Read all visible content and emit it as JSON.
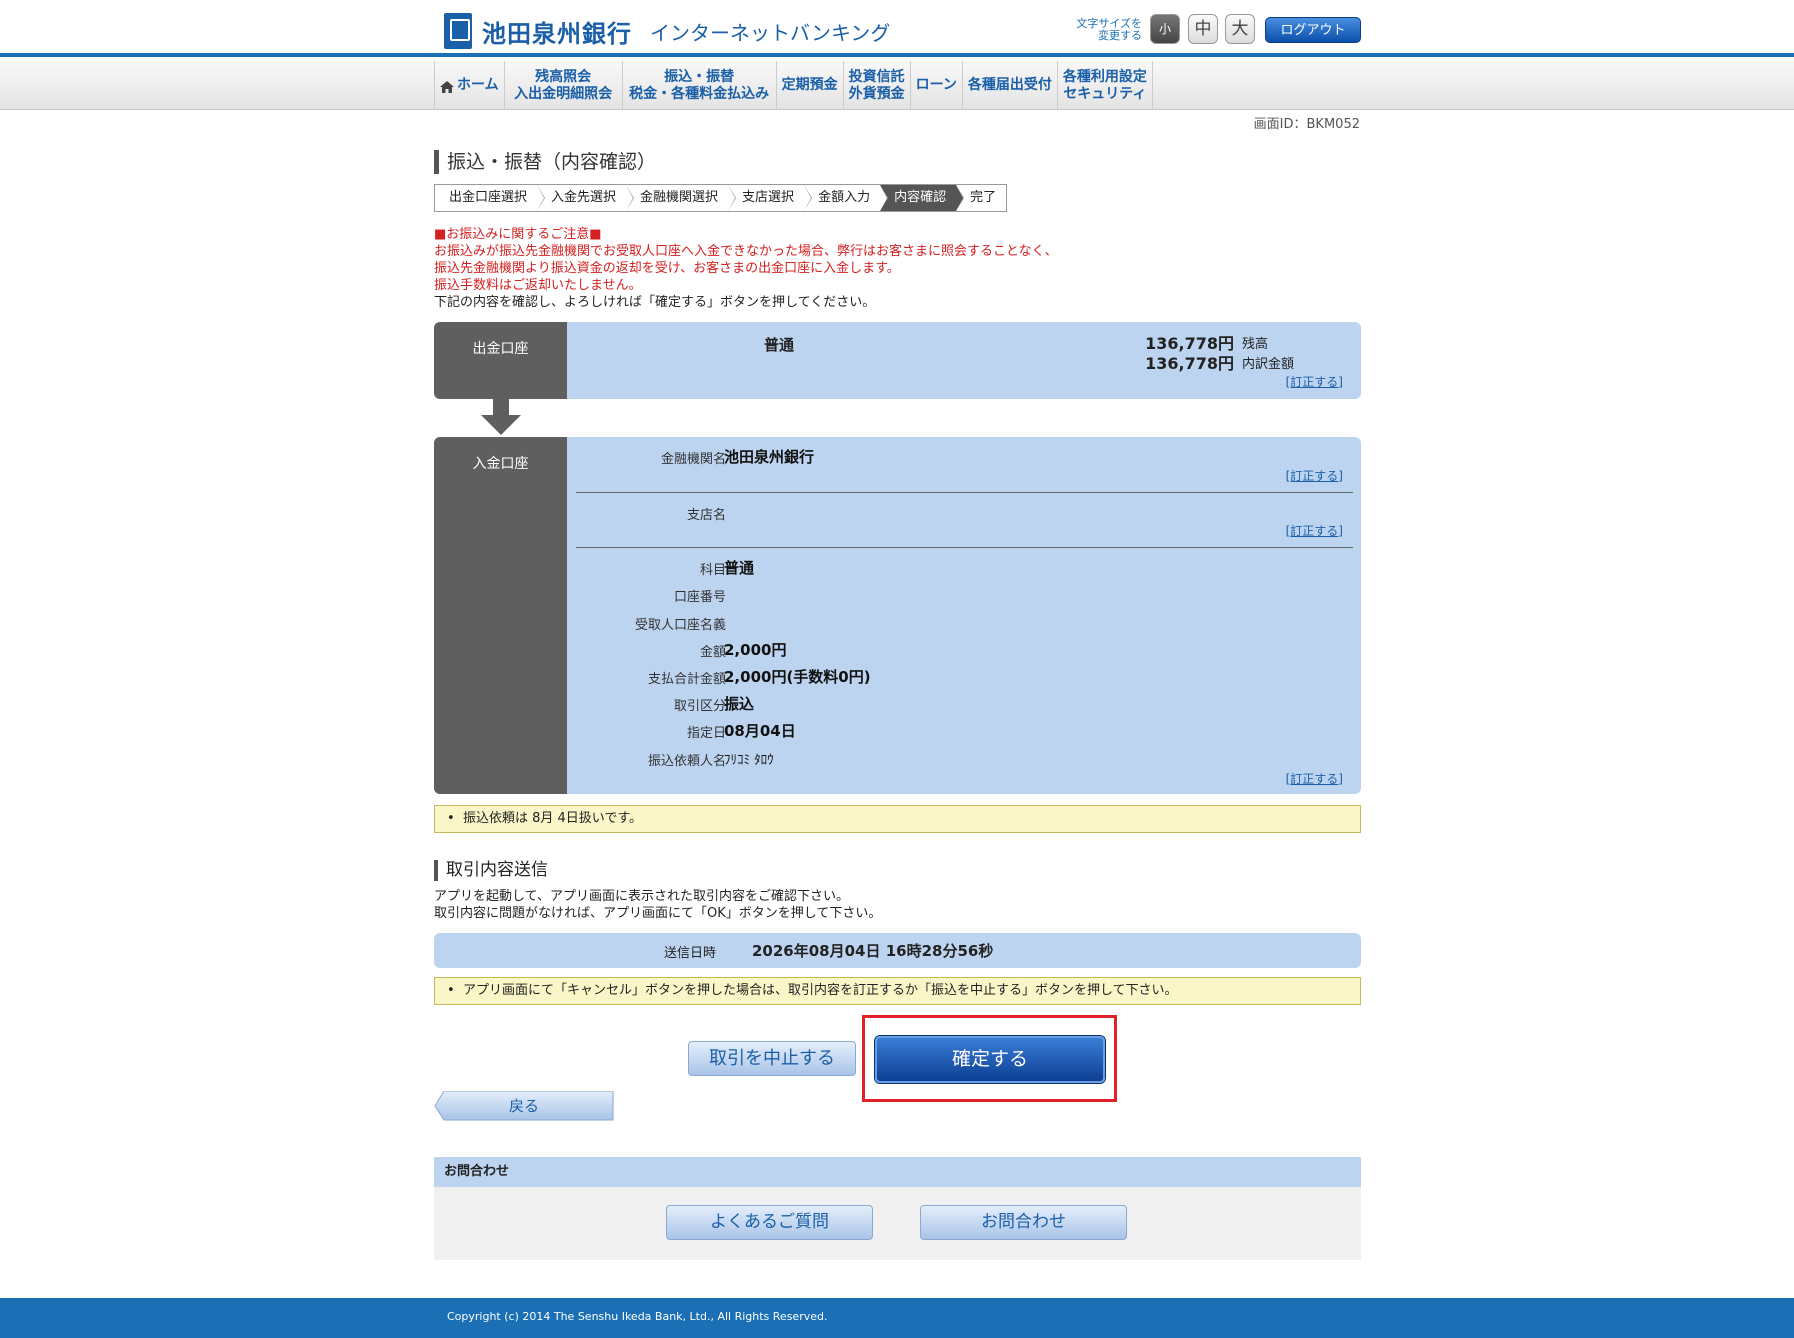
{
  "header": {
    "bank_name": "池田泉州銀行",
    "service_name": "インターネットバンキング",
    "font_size_label": "文字サイズを変更する",
    "font_small": "小",
    "font_medium": "中",
    "font_large": "大",
    "logout": "ログアウト"
  },
  "nav": {
    "items": [
      {
        "label": "ホーム",
        "icon": "home-icon"
      },
      {
        "label": "残高照会\n入出金明細照会"
      },
      {
        "label": "振込・振替\n税金・各種料金払込み"
      },
      {
        "label": "定期預金"
      },
      {
        "label": "投資信託\n外貨預金"
      },
      {
        "label": "ローン"
      },
      {
        "label": "各種届出受付"
      },
      {
        "label": "各種利用設定\nセキュリティ"
      }
    ]
  },
  "screen_id": "画面ID：BKM052",
  "page_title": "振込・振替（内容確認）",
  "steps": [
    "出金口座選択",
    "入金先選択",
    "金融機関選択",
    "支店選択",
    "金額入力",
    "内容確認",
    "完了"
  ],
  "notice": {
    "heading": "■お振込みに関するご注意■",
    "line1": "お振込みが振込先金融機関でお受取人口座へ入金できなかった場合、弊行はお客さまに照会することなく、",
    "line2": "振込先金融機関より振込資金の返却を受け、お客さまの出金口座に入金します。",
    "line3": "振込手数料はご返却いたしません。",
    "instruction": "下記の内容を確認し、よろしければ「確定する」ボタンを押してください。"
  },
  "debit": {
    "label": "出金口座",
    "account_type": "普通",
    "balance": "136,778円",
    "balance_label": "残高",
    "breakdown": "136,778円",
    "breakdown_label": "内訳金額",
    "fix": "[訂正する]"
  },
  "credit": {
    "label": "入金口座",
    "bank_label": "金融機関名",
    "bank_value": "池田泉州銀行",
    "branch_label": "支店名",
    "branch_value": "",
    "subject_label": "科目",
    "subject_value": "普通",
    "account_no_label": "口座番号",
    "account_no_value": "",
    "payee_label": "受取人口座名義",
    "payee_value": "",
    "amount_label": "金額",
    "amount_value": "2,000円",
    "total_label": "支払合計金額",
    "total_value": "2,000円(手数料0円)",
    "txn_type_label": "取引区分",
    "txn_type_value": "振込",
    "date_label": "指定日",
    "date_value": "08月04日",
    "requester_label": "振込依頼人名",
    "requester_value": "ﾌﾘｺﾐ ﾀﾛｳ",
    "fix": "[訂正する]"
  },
  "note1": "振込依頼は 8月 4日扱いです。",
  "section2": {
    "title": "取引内容送信",
    "line1": "アプリを起動して、アプリ画面に表示された取引内容をご確認下さい。",
    "line2": "取引内容に問題がなければ、アプリ画面にて「OK」ボタンを押して下さい。",
    "send_time_label": "送信日時",
    "send_time_value": "2026年08月04日 16時28分56秒"
  },
  "note2": "アプリ画面にて「キャンセル」ボタンを押した場合は、取引内容を訂正するか「振込を中止する」ボタンを押して下さい。",
  "buttons": {
    "cancel": "取引を中止する",
    "confirm": "確定する",
    "back": "戻る"
  },
  "contact": {
    "heading": "お問合わせ",
    "faq": "よくあるご質問",
    "inquiry": "お問合わせ"
  },
  "footer": {
    "copyright": "Copyright (c) 2014 The Senshu Ikeda Bank, Ltd., All Rights Reserved."
  }
}
